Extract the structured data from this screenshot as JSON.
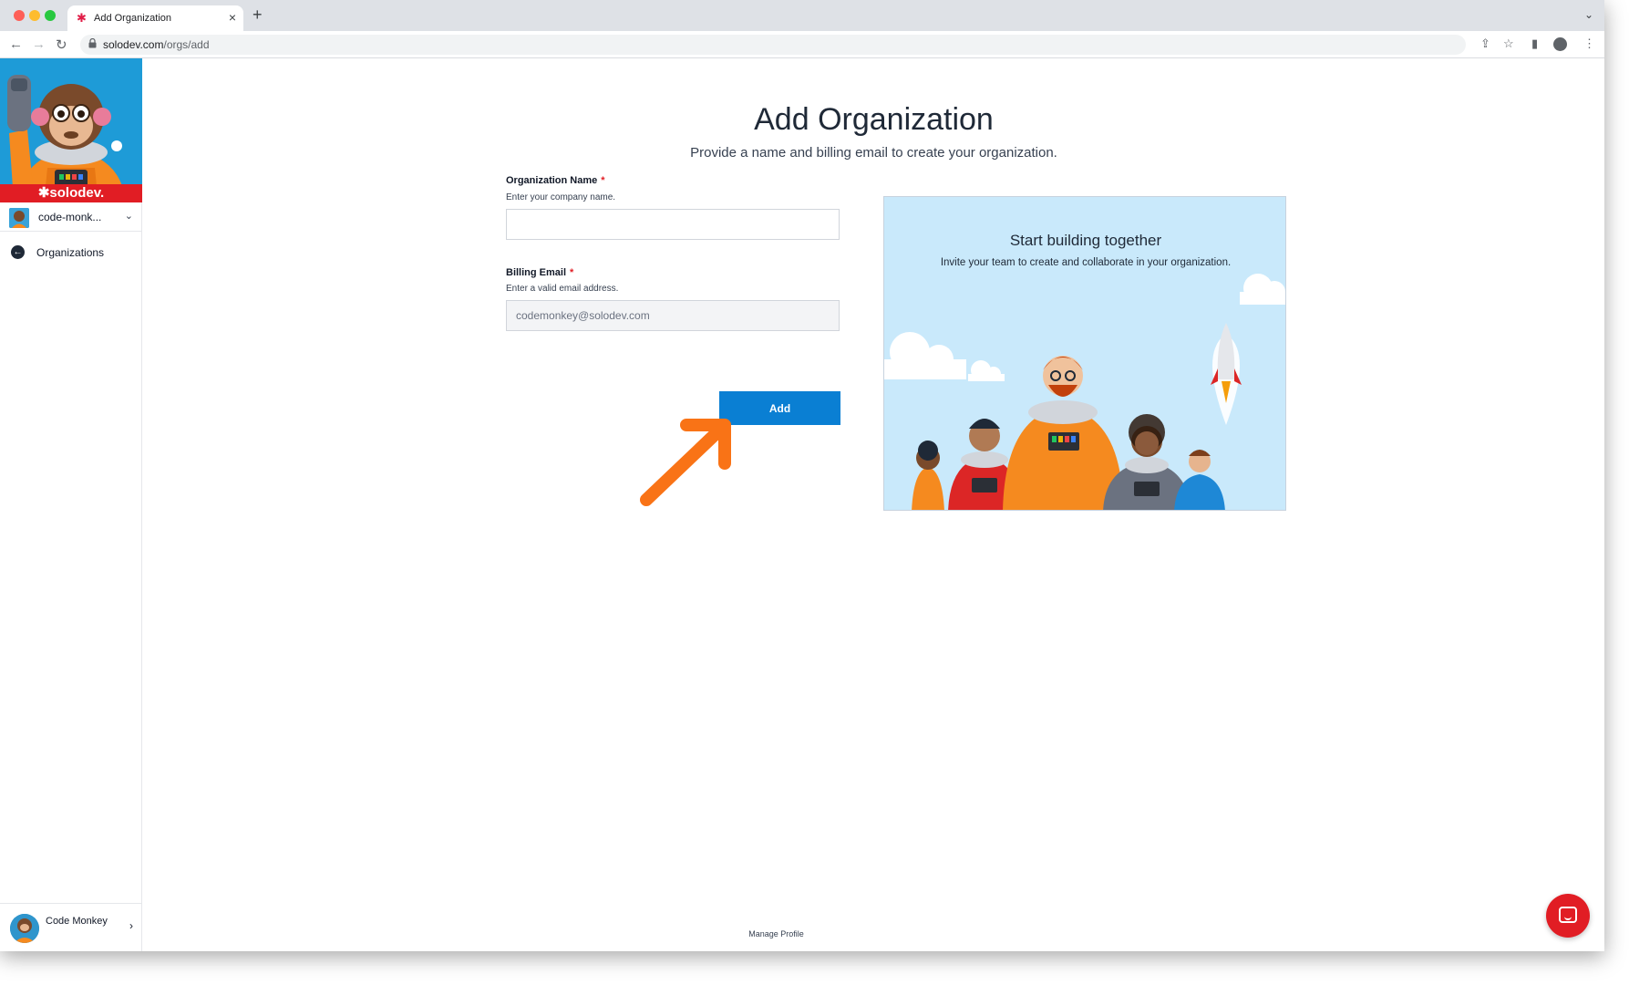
{
  "browser": {
    "tab_title": "Add Organization",
    "url_host": "solodev.com",
    "url_path": "/orgs/add"
  },
  "sidebar": {
    "brand": "solodev.",
    "org_selector": "code-monk...",
    "nav": [
      {
        "label": "Organizations",
        "icon": "arrow-left-circle-icon"
      }
    ],
    "profile": {
      "name": "Code Monkey",
      "action": "Manage Profile"
    }
  },
  "page": {
    "title": "Add Organization",
    "subtitle": "Provide a name and billing email to create your organization."
  },
  "form": {
    "org_name_label": "Organization Name",
    "org_name_help": "Enter your company name.",
    "org_name_value": "",
    "email_label": "Billing Email",
    "email_help": "Enter a valid email address.",
    "email_value": "codemonkey@solodev.com",
    "required_mark": "*",
    "submit_label": "Add"
  },
  "promo": {
    "title": "Start building together",
    "text": "Invite your team to create and collaborate in your organization."
  },
  "colors": {
    "accent": "#0a7fd3",
    "brand_red": "#e11d24",
    "annotation_arrow": "#f97316"
  }
}
